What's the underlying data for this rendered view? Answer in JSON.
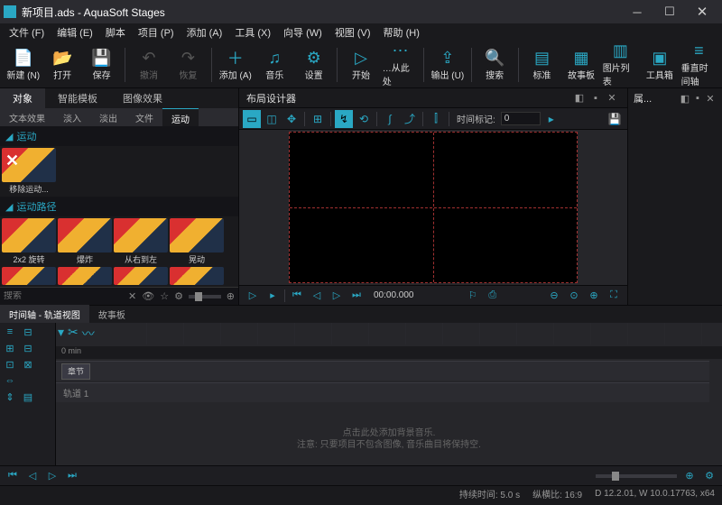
{
  "titlebar": {
    "title": "新项目.ads - AquaSoft Stages"
  },
  "menu": [
    "文件 (F)",
    "编辑 (E)",
    "脚本",
    "项目 (P)",
    "添加 (A)",
    "工具 (X)",
    "向导 (W)",
    "视图 (V)",
    "帮助 (H)"
  ],
  "toolbar": [
    {
      "label": "新建 (N)",
      "icon": "📄"
    },
    {
      "label": "打开",
      "icon": "📂"
    },
    {
      "label": "保存",
      "icon": "💾"
    },
    {
      "label": "撤消",
      "icon": "↶",
      "dim": true
    },
    {
      "label": "恢复",
      "icon": "↷",
      "dim": true
    },
    {
      "label": "添加 (A)",
      "icon": "＋"
    },
    {
      "label": "音乐",
      "icon": "♫"
    },
    {
      "label": "设置",
      "icon": "⚙"
    },
    {
      "label": "开始",
      "icon": "▷"
    },
    {
      "label": "…从此处",
      "icon": "⋯"
    },
    {
      "label": "输出 (U)",
      "icon": "⇪"
    },
    {
      "label": "搜索",
      "icon": "🔍"
    },
    {
      "label": "标准",
      "icon": "▤"
    },
    {
      "label": "故事板",
      "icon": "▦"
    },
    {
      "label": "图片列表",
      "icon": "▥"
    },
    {
      "label": "工具箱",
      "icon": "▣"
    },
    {
      "label": "垂直时间轴",
      "icon": "≡"
    }
  ],
  "left": {
    "tabs1": [
      "对象",
      "智能模板",
      "图像效果"
    ],
    "tabs2": [
      "文本效果",
      "淡入",
      "淡出",
      "文件",
      "运动"
    ],
    "tabs1_active": 0,
    "tabs2_active": 4,
    "section1": "运动",
    "thumb_remove": "移除运动...",
    "section2": "运动路径",
    "thumbs": [
      "2x2 旋转",
      "爆炸",
      "从右到左",
      "晃动"
    ],
    "search_placeholder": "搜索"
  },
  "design": {
    "title": "布局设计器",
    "time_label": "时间标记:",
    "time_value": "0",
    "timecode": "00:00.000"
  },
  "props": {
    "title": "属..."
  },
  "tl": {
    "tabs": [
      "时间轴 - 轨道视图",
      "故事板"
    ],
    "active": 0,
    "ruler": "0 min",
    "clip": "章节",
    "track": "轨道 1",
    "hint1": "点击此处添加背景音乐.",
    "hint2": "注意: 只要项目不包含图像, 音乐曲目将保持空."
  },
  "status": {
    "duration": "持续时间: 5.0 s",
    "aspect": "纵横比: 16:9",
    "version": "D 12.2.01, W 10.0.17763, x64"
  }
}
